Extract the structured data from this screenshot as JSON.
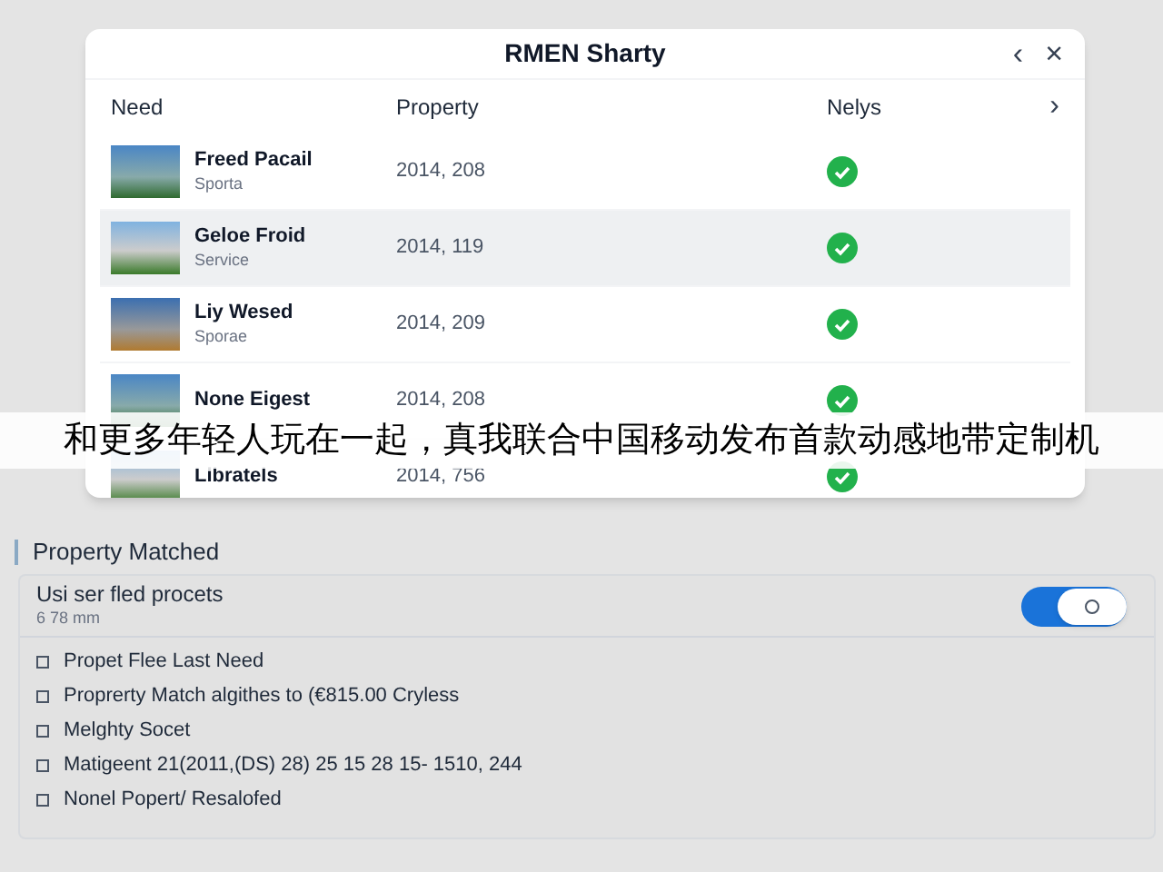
{
  "window": {
    "title": "RMEN Sharty",
    "back_glyph": "‹",
    "close_glyph": "×"
  },
  "table": {
    "columns": [
      "Need",
      "Property",
      "Nelys"
    ],
    "next_glyph": "›",
    "rows": [
      {
        "name": "Freed Pacail",
        "subtitle": "Sporta",
        "property": "2014, 208",
        "matched": true,
        "selected": false
      },
      {
        "name": "Geloe Froid",
        "subtitle": "Service",
        "property": "2014, 119",
        "matched": true,
        "selected": true
      },
      {
        "name": "Liy Wesed",
        "subtitle": "Sporae",
        "property": "2014, 209",
        "matched": true,
        "selected": false
      },
      {
        "name": "None Eigest",
        "subtitle": "",
        "property": "2014, 208",
        "matched": true,
        "selected": false
      },
      {
        "name": "Libratels",
        "subtitle": "",
        "property": "2014, 756",
        "matched": true,
        "selected": false
      }
    ]
  },
  "banner": {
    "text": "和更多年轻人玩在一起，真我联合中国移动发布首款动感地带定制机"
  },
  "section": {
    "title": "Property Matched",
    "setting": {
      "label": "Usi ser fled procets",
      "sublabel": "6 78 mm",
      "on": true
    },
    "items": [
      {
        "label": "Propet Flee Last Need",
        "checked": false
      },
      {
        "label": "Proprerty Match algithes to (€815.00 Cryless",
        "checked": false
      },
      {
        "label": "Melghty Socet",
        "checked": false
      },
      {
        "label": "Matigeent 21(2011,(DS) 28) 25 15 28 15- 1510, 244",
        "checked": false
      },
      {
        "label": "Nonel Popert/ Resalofed",
        "checked": false
      }
    ]
  }
}
